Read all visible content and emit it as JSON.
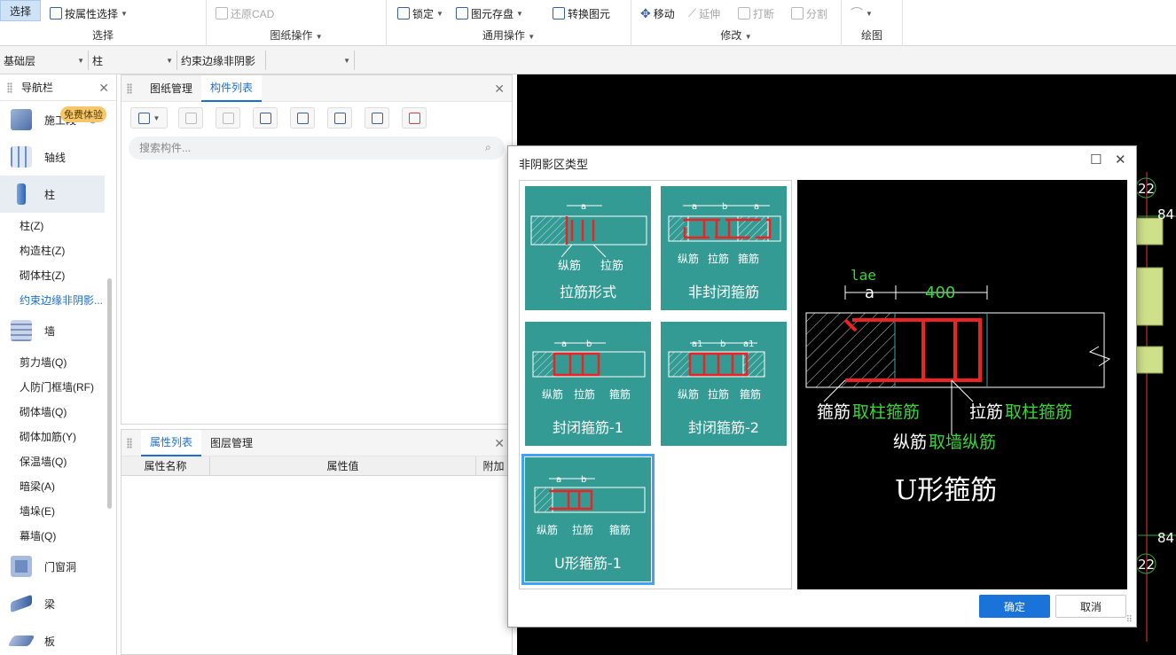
{
  "ribbon": {
    "select_label": "选择",
    "filter_select_label": "按属性选择",
    "restore_cad_label": "还原CAD",
    "lock_label": "锁定",
    "store_label": "图元存盘",
    "convert_label": "转换图元",
    "move_label": "移动",
    "extend_label": "延伸",
    "break_label": "打断",
    "split_label": "分割",
    "groups": {
      "select": "选择",
      "drawing_ops": "图纸操作",
      "common_ops": "通用操作",
      "modify": "修改",
      "draw": "绘图"
    }
  },
  "filters": {
    "floor": "基础层",
    "category": "柱",
    "component": "约束边缘非阴影",
    "extra": ""
  },
  "nav": {
    "title": "导航栏",
    "trial_badge": "免费体验",
    "categories": {
      "construction": "施工段",
      "axis": "轴线",
      "column": "柱",
      "wall": "墙",
      "door_window": "门窗洞",
      "beam": "梁",
      "slab": "板"
    },
    "column_items": [
      "柱(Z)",
      "构造柱(Z)",
      "砌体柱(Z)",
      "约束边缘非阴影..."
    ],
    "wall_items": [
      "剪力墙(Q)",
      "人防门框墙(RF)",
      "砌体墙(Q)",
      "砌体加筋(Y)",
      "保温墙(Q)",
      "暗梁(A)",
      "墙垛(E)",
      "幕墙(Q)"
    ]
  },
  "component_panel": {
    "tab_drawings": "图纸管理",
    "tab_components": "构件列表",
    "search_placeholder": "搜索构件..."
  },
  "property_panel": {
    "tab_props": "属性列表",
    "tab_layers": "图层管理",
    "col_name": "属性名称",
    "col_value": "属性值",
    "col_extra": "附加"
  },
  "canvas": {
    "labels": [
      "22",
      "84",
      "84",
      "22"
    ]
  },
  "dialog": {
    "title": "非阴影区类型",
    "ok": "确定",
    "cancel": "取消",
    "options": [
      {
        "label": "拉筋形式",
        "notes": [
          "纵筋",
          "拉筋"
        ],
        "dims": [
          "a"
        ]
      },
      {
        "label": "非封闭箍筋",
        "notes": [
          "纵筋",
          "拉筋",
          "箍筋"
        ],
        "dims": [
          "a",
          "b",
          "a"
        ]
      },
      {
        "label": "封闭箍筋-1",
        "notes": [
          "纵筋",
          "拉筋",
          "箍筋"
        ],
        "dims": [
          "a",
          "b"
        ]
      },
      {
        "label": "封闭箍筋-2",
        "notes": [
          "纵筋",
          "拉筋",
          "箍筋"
        ],
        "dims": [
          "a1",
          "b",
          "a1"
        ]
      },
      {
        "label": "U形箍筋-1",
        "notes": [
          "纵筋",
          "拉筋",
          "箍筋"
        ],
        "dims": [
          "a",
          "b"
        ]
      }
    ],
    "selected_index": 4,
    "preview": {
      "dim_lae": "lae",
      "dim_a": "a",
      "dim_400": "400",
      "stirrup": "箍筋",
      "stirrup_source": "取柱箍筋",
      "tie": "拉筋",
      "tie_source": "取柱箍筋",
      "long_bar": "纵筋",
      "long_bar_source": "取墙纵筋",
      "type_name": "U形箍筋"
    }
  }
}
